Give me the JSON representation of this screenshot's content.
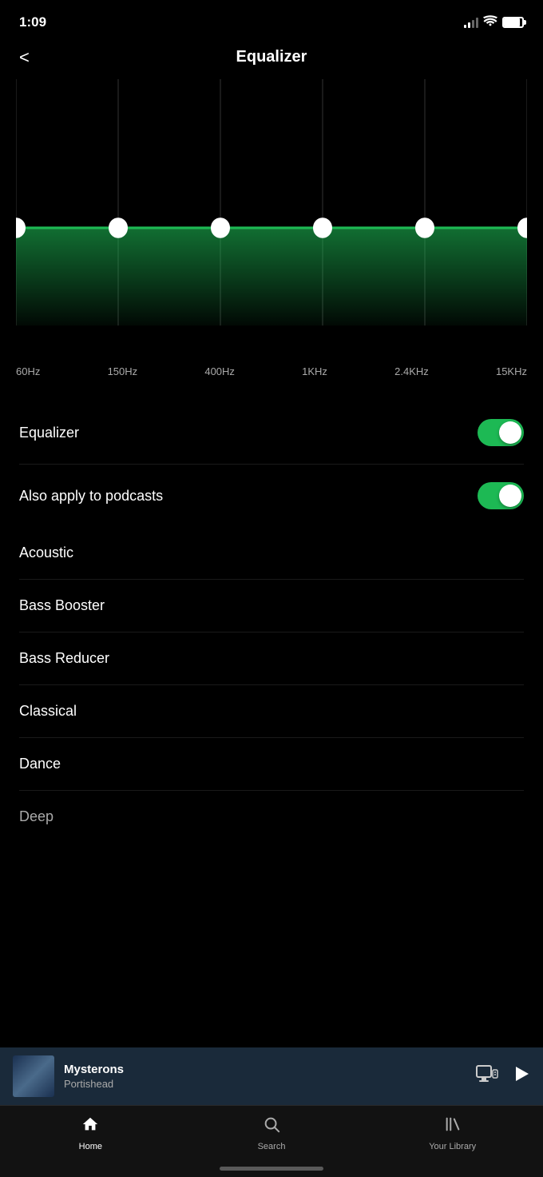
{
  "statusBar": {
    "time": "1:09"
  },
  "header": {
    "backLabel": "<",
    "title": "Equalizer"
  },
  "eqGraph": {
    "frequencies": [
      "60Hz",
      "150Hz",
      "400Hz",
      "1KHz",
      "2.4KHz",
      "15KHz"
    ],
    "pointPositions": [
      0,
      1,
      2,
      3,
      4,
      5
    ]
  },
  "settings": [
    {
      "id": "equalizer-toggle",
      "label": "Equalizer",
      "enabled": true
    },
    {
      "id": "podcast-toggle",
      "label": "Also apply to podcasts",
      "enabled": true
    }
  ],
  "presets": [
    {
      "id": "acoustic",
      "label": "Acoustic"
    },
    {
      "id": "bass-booster",
      "label": "Bass Booster"
    },
    {
      "id": "bass-reducer",
      "label": "Bass Reducer"
    },
    {
      "id": "classical",
      "label": "Classical"
    },
    {
      "id": "dance",
      "label": "Dance"
    },
    {
      "id": "deep",
      "label": "Deep",
      "partial": true
    }
  ],
  "nowPlaying": {
    "trackName": "Mysterons",
    "artistName": "Portishead"
  },
  "tabBar": {
    "tabs": [
      {
        "id": "home",
        "label": "Home",
        "active": true,
        "icon": "home"
      },
      {
        "id": "search",
        "label": "Search",
        "active": false,
        "icon": "search"
      },
      {
        "id": "library",
        "label": "Your Library",
        "active": false,
        "icon": "library"
      }
    ]
  }
}
